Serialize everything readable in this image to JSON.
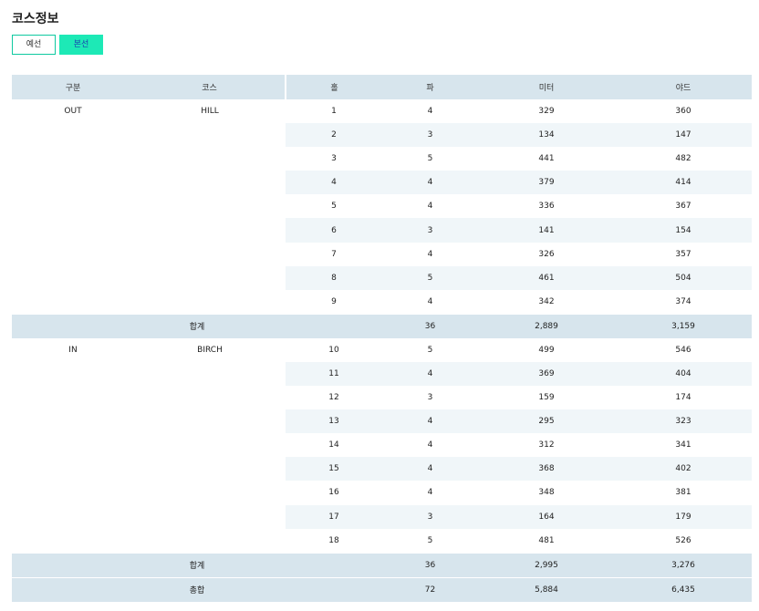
{
  "page": {
    "title": "코스정보"
  },
  "tabs": [
    {
      "label": "예선",
      "active": false
    },
    {
      "label": "본선",
      "active": true
    }
  ],
  "table": {
    "headers": [
      "구분",
      "코스",
      "홀",
      "파",
      "미터",
      "야드"
    ],
    "sections": [
      {
        "division": "OUT",
        "course": "HILL",
        "rows": [
          [
            "1",
            "4",
            "329",
            "360"
          ],
          [
            "2",
            "3",
            "134",
            "147"
          ],
          [
            "3",
            "5",
            "441",
            "482"
          ],
          [
            "4",
            "4",
            "379",
            "414"
          ],
          [
            "5",
            "4",
            "336",
            "367"
          ],
          [
            "6",
            "3",
            "141",
            "154"
          ],
          [
            "7",
            "4",
            "326",
            "357"
          ],
          [
            "8",
            "5",
            "461",
            "504"
          ],
          [
            "9",
            "4",
            "342",
            "374"
          ]
        ],
        "subtotal": {
          "label": "합계",
          "par": "36",
          "meter": "2,889",
          "yard": "3,159"
        }
      },
      {
        "division": "IN",
        "course": "BIRCH",
        "rows": [
          [
            "10",
            "5",
            "499",
            "546"
          ],
          [
            "11",
            "4",
            "369",
            "404"
          ],
          [
            "12",
            "3",
            "159",
            "174"
          ],
          [
            "13",
            "4",
            "295",
            "323"
          ],
          [
            "14",
            "4",
            "312",
            "341"
          ],
          [
            "15",
            "4",
            "368",
            "402"
          ],
          [
            "16",
            "4",
            "348",
            "381"
          ],
          [
            "17",
            "3",
            "164",
            "179"
          ],
          [
            "18",
            "5",
            "481",
            "526"
          ]
        ],
        "subtotal": {
          "label": "합계",
          "par": "36",
          "meter": "2,995",
          "yard": "3,276"
        }
      }
    ],
    "total": {
      "label": "총합",
      "par": "72",
      "meter": "5,884",
      "yard": "6,435"
    }
  },
  "colors": {
    "header_bg": "#d7e5ed",
    "stripe_bg": "#f0f6f9",
    "tab_active_bg": "#1de9b6",
    "tab_border": "#0fc9a0"
  }
}
